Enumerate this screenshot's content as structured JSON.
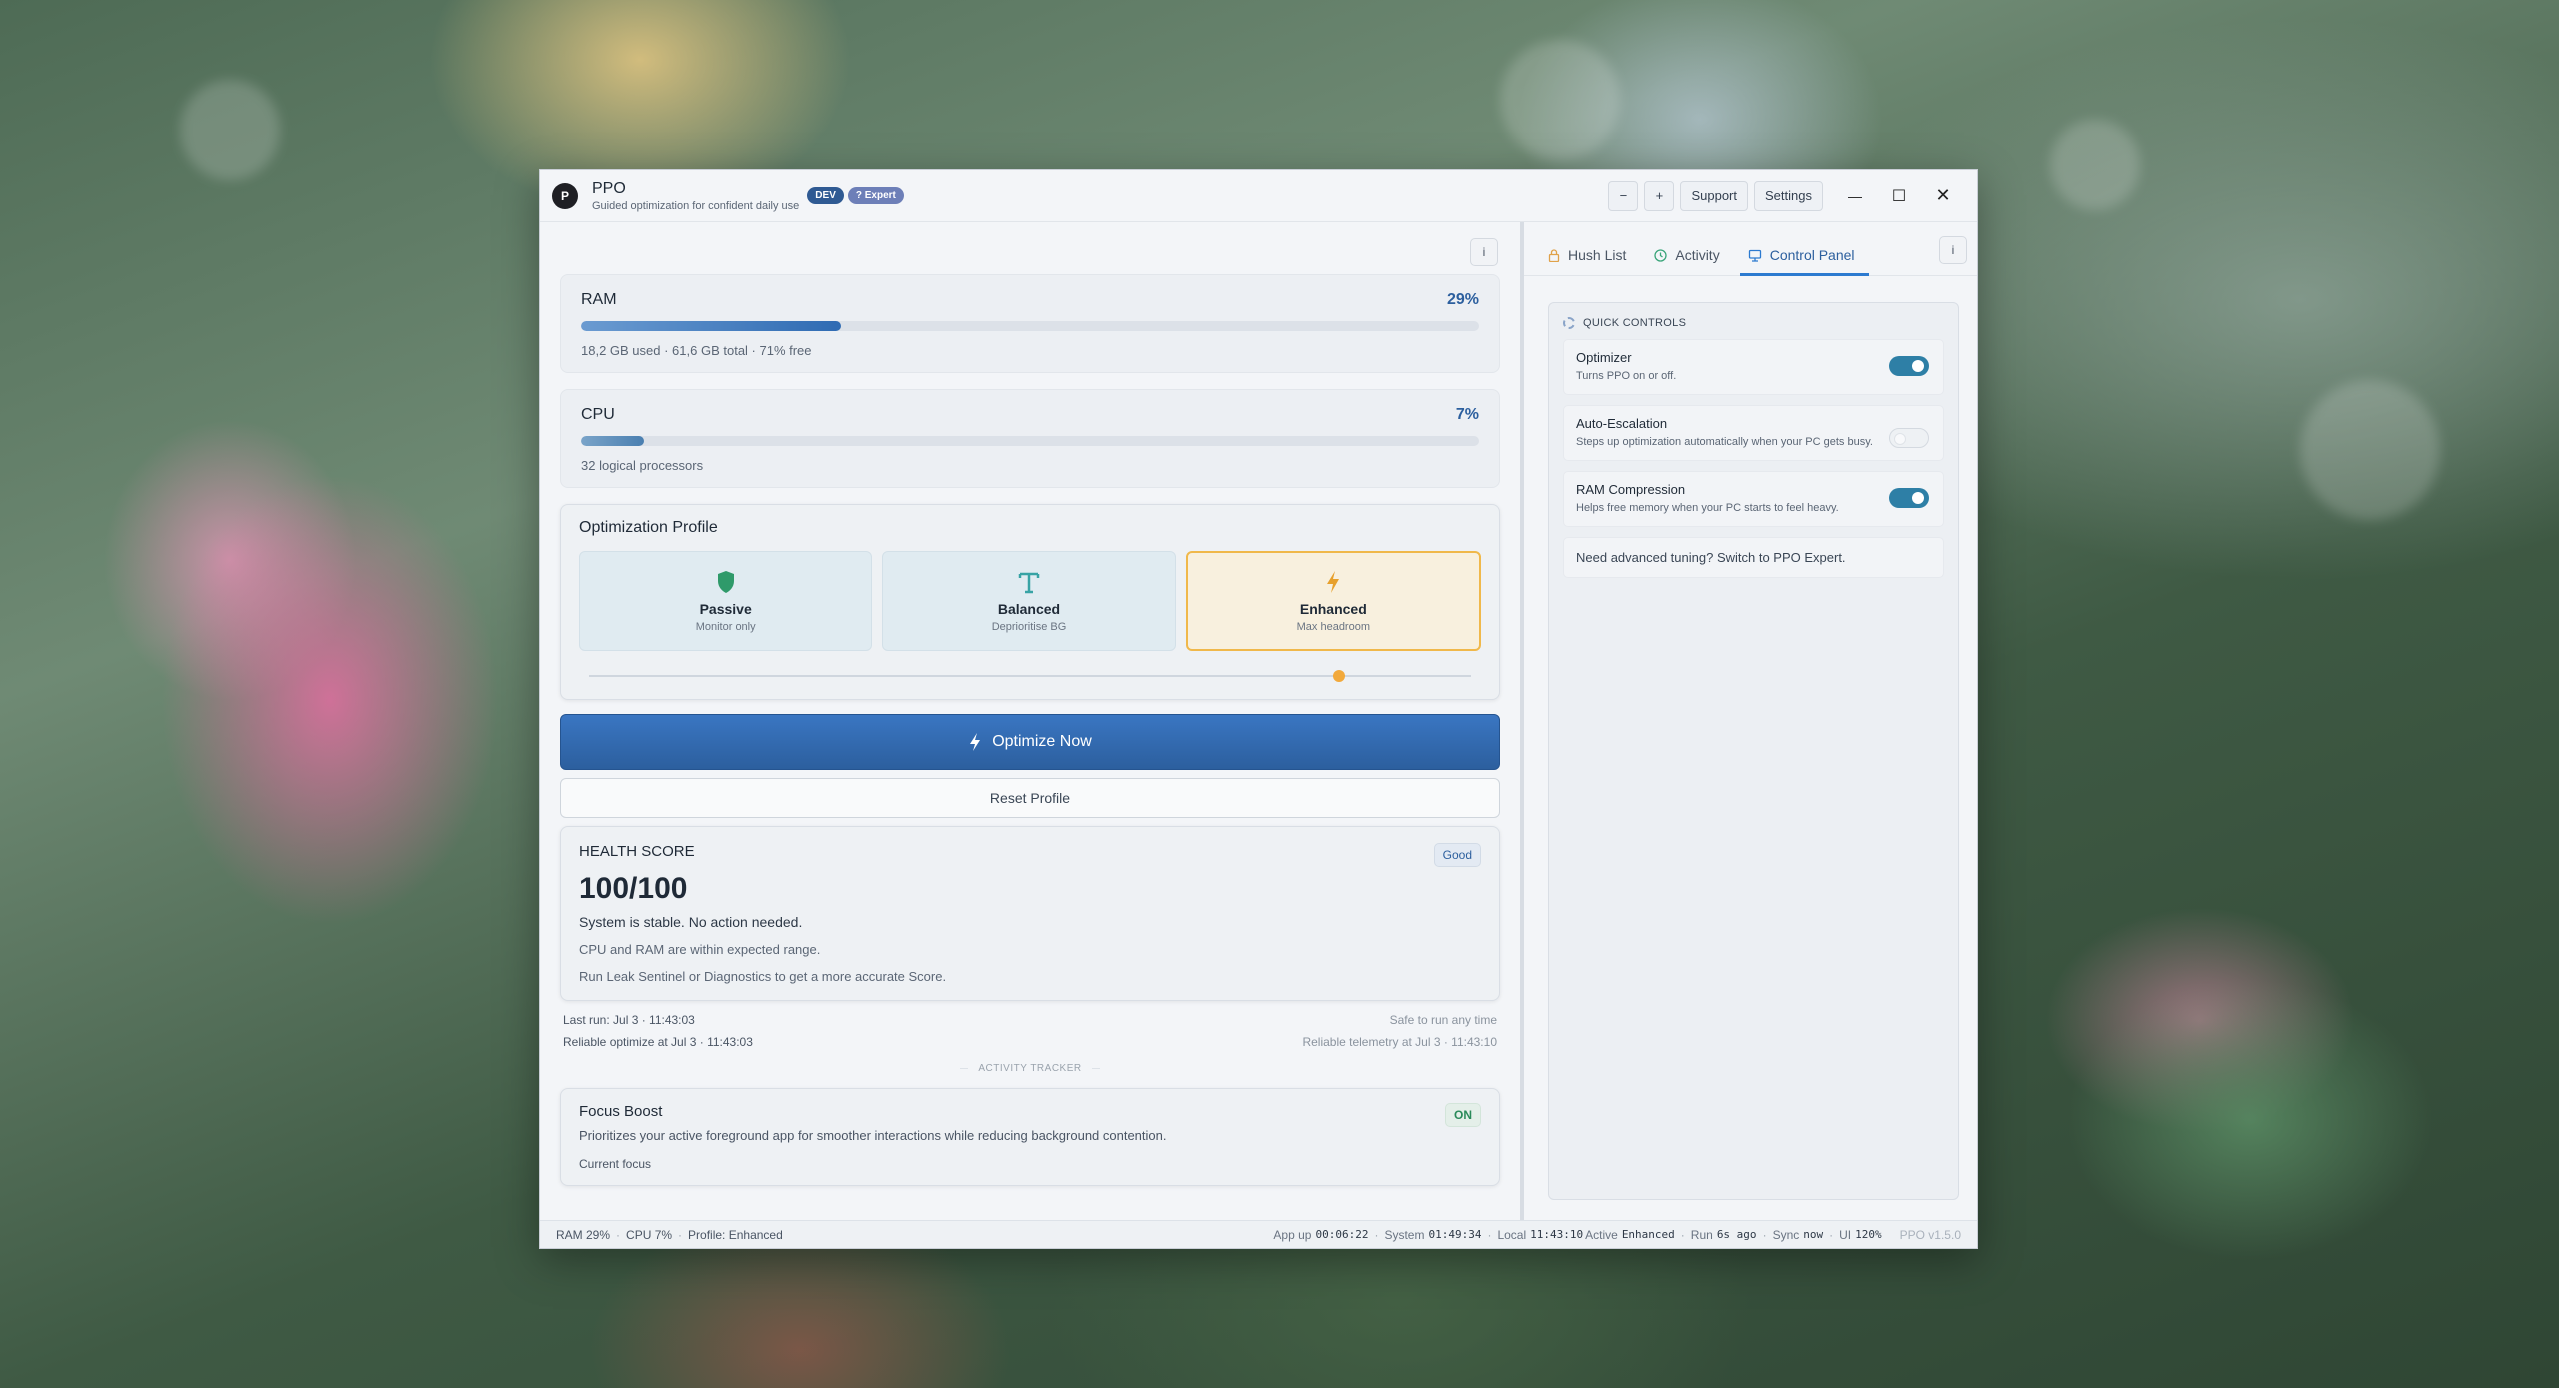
{
  "app": {
    "logo_letter": "P",
    "title": "PPO",
    "subtitle": "Guided optimization for confident daily use",
    "badge_dev": "DEV",
    "badge_expert": "? Expert"
  },
  "titlebar": {
    "zoom_out": "−",
    "zoom_in": "+",
    "support": "Support",
    "settings": "Settings",
    "minimize": "—",
    "maximize": "☐",
    "close": "✕"
  },
  "info_label": "i",
  "metrics": {
    "ram": {
      "name": "RAM",
      "pct": "29%",
      "fill": 0.29,
      "detail": "18,2 GB used  ·  61,6 GB total  ·  71% free"
    },
    "cpu": {
      "name": "CPU",
      "pct": "7%",
      "fill": 0.07,
      "detail": "32 logical processors"
    }
  },
  "profile": {
    "title": "Optimization Profile",
    "options": [
      {
        "name": "Passive",
        "desc": "Monitor only",
        "icon": "shield-icon",
        "color": "#2f9a6a"
      },
      {
        "name": "Balanced",
        "desc": "Deprioritise BG",
        "icon": "text-t-icon",
        "color": "#38a3a5"
      },
      {
        "name": "Enhanced",
        "desc": "Max headroom",
        "icon": "bolt-icon",
        "color": "#e7a02c"
      }
    ],
    "selected": "Enhanced",
    "slider_level": 0.85
  },
  "actions": {
    "optimize": "Optimize Now",
    "reset": "Reset Profile"
  },
  "health": {
    "label": "HEALTH SCORE",
    "badge": "Good",
    "score": "100/100",
    "status": "System is stable. No action needed.",
    "detail1": "CPU and RAM are within expected range.",
    "detail2": "Run Leak Sentinel or Diagnostics to get a more accurate Score."
  },
  "run_info": {
    "last_run": "Last run: Jul 3 · 11:43:03",
    "reliable": "Reliable optimize at Jul 3 · 11:43:03",
    "safe": "Safe to run any time",
    "telemetry": "Reliable telemetry at Jul 3 · 11:43:10"
  },
  "tracker_label": "ACTIVITY TRACKER",
  "focus": {
    "title": "Focus Boost",
    "badge": "ON",
    "desc": "Prioritizes your active foreground app for smoother interactions while reducing background contention.",
    "sub": "Current focus"
  },
  "tabs": [
    {
      "label": "Hush List",
      "icon": "lock-icon"
    },
    {
      "label": "Activity",
      "icon": "clock-icon"
    },
    {
      "label": "Control Panel",
      "icon": "monitor-icon"
    }
  ],
  "active_tab": "Control Panel",
  "quick_controls": {
    "header": "QUICK CONTROLS",
    "items": [
      {
        "title": "Optimizer",
        "desc": "Turns PPO on or off.",
        "on": true
      },
      {
        "title": "Auto-Escalation",
        "desc": "Steps up optimization automatically when your PC gets busy.",
        "on": false
      },
      {
        "title": "RAM Compression",
        "desc": "Helps free memory when your PC starts to feel heavy.",
        "on": true
      }
    ],
    "note": "Need advanced tuning? Switch to PPO Expert."
  },
  "statusbar": {
    "ram": "RAM 29%",
    "cpu": "CPU 7%",
    "profile": "Profile: Enhanced",
    "app_label": "App up",
    "app_time": "00:06:22",
    "system_label": "System",
    "system_time": "01:49:34",
    "local_label": "Local",
    "local_time": "11:43:10",
    "active_label": "Active",
    "active_value": "Enhanced",
    "run_label": "Run",
    "run_value": "6s ago",
    "sync_label": "Sync",
    "sync_value": "now",
    "ui_label": "UI",
    "ui_value": "120%",
    "version": "PPO v1.5.0"
  }
}
